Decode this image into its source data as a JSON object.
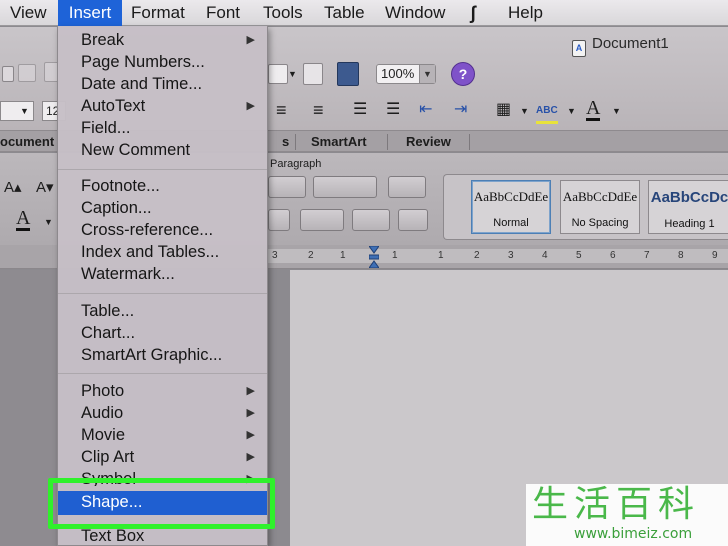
{
  "menubar": {
    "items": [
      "View",
      "Insert",
      "Format",
      "Font",
      "Tools",
      "Table",
      "Window",
      "Help"
    ],
    "script_glyph": "ʃ"
  },
  "window": {
    "document_title": "Document1"
  },
  "toolbar": {
    "zoom": "100%",
    "help": "?",
    "font_size": "12"
  },
  "ribbon": {
    "tabs": [
      "ocument",
      "s",
      "SmartArt",
      "Review"
    ],
    "group_label": "Paragraph",
    "styles": [
      {
        "sample": "AaBbCcDdEe",
        "name": "Normal"
      },
      {
        "sample": "AaBbCcDdEe",
        "name": "No Spacing"
      },
      {
        "sample": "AaBbCcDc",
        "name": "Heading 1"
      }
    ],
    "format_glyphs": {
      "font_color": "A",
      "highlight": "ABC"
    }
  },
  "ruler": {
    "numbers": [
      "3",
      "2",
      "1",
      "1",
      "1",
      "2",
      "3",
      "4",
      "5",
      "6",
      "7",
      "8",
      "9"
    ]
  },
  "insert_menu": {
    "items": [
      {
        "label": "Break",
        "submenu": true
      },
      {
        "label": "Page Numbers...",
        "submenu": false
      },
      {
        "label": "Date and Time...",
        "submenu": false
      },
      {
        "label": "AutoText",
        "submenu": true
      },
      {
        "label": "Field...",
        "submenu": false
      },
      {
        "label": "New Comment",
        "submenu": false
      },
      {
        "label": "Footnote...",
        "submenu": false
      },
      {
        "label": "Caption...",
        "submenu": false
      },
      {
        "label": "Cross-reference...",
        "submenu": false
      },
      {
        "label": "Index and Tables...",
        "submenu": false
      },
      {
        "label": "Watermark...",
        "submenu": false
      },
      {
        "label": "Table...",
        "submenu": false
      },
      {
        "label": "Chart...",
        "submenu": false
      },
      {
        "label": "SmartArt Graphic...",
        "submenu": false
      },
      {
        "label": "Photo",
        "submenu": true
      },
      {
        "label": "Audio",
        "submenu": true
      },
      {
        "label": "Movie",
        "submenu": true
      },
      {
        "label": "Clip Art",
        "submenu": true
      },
      {
        "label": "Symbol",
        "submenu": true
      },
      {
        "label": "Shape...",
        "submenu": false,
        "highlighted": true
      },
      {
        "label": "Text Box",
        "submenu": false
      }
    ],
    "submenu_arrow": "▶"
  },
  "watermark": {
    "brand": "生活百科",
    "url": "www.bimeiz.com"
  },
  "colors": {
    "menu_highlight": "#1f5fd1",
    "callout_border": "#2ff12b",
    "watermark_green": "#4ab84a"
  }
}
